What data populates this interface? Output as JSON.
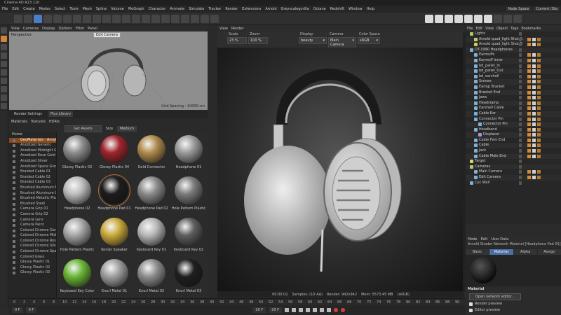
{
  "app": {
    "title": "Cinema 4D R23.110"
  },
  "menu": {
    "items": [
      "File",
      "Edit",
      "Create",
      "Modes",
      "Select",
      "Tools",
      "Mesh",
      "Spline",
      "Volume",
      "MoGraph",
      "Character",
      "Animate",
      "Simulate",
      "Tracker",
      "Render",
      "Extensions",
      "Arnold",
      "Greyscalegorilla",
      "Octane",
      "Redshift",
      "Window",
      "Help"
    ],
    "node_space": "Node Space",
    "node_space_value": "Current (Sta"
  },
  "viewport": {
    "menu": [
      "View",
      "Cameras",
      "Display",
      "Options",
      "Filter",
      "Panel"
    ],
    "label": "Perspective",
    "camera": "Edit Camera",
    "grid_spacing": "Grid Spacing : 10000 cm"
  },
  "material_manager": {
    "tabs": [
      "Render Settings",
      "Plus Library"
    ],
    "menu": [
      "Materials",
      "Textures",
      "HDRIs"
    ],
    "get_assets": "Get Assets",
    "size_label": "Size",
    "size_value": "Medium",
    "list_head": "Home",
    "list_selected": "GeoMaterials - Arnold",
    "list": [
      "Anodized Generic",
      "Anodized Midnight Gre",
      "Anodized Rose Gold",
      "Anodized Silver",
      "Anodized Space Grey",
      "Braided Cable 01",
      "Braided Cable 02",
      "Braided Cable 03",
      "Brushed Aluminum Ble",
      "Brushed Aluminum Gra",
      "Brushed Metallic Plastic",
      "Brushed Steel",
      "Camera Grip 01",
      "Camera Grip 02",
      "Camera Lens",
      "Camera Paint",
      "Colored Chrome Gener",
      "Colored Chrome Midni",
      "Colored Chrome Rose",
      "Colored Chrome Silver",
      "Colored Chrome Space",
      "Colored Glass",
      "Glossy Plastic 01",
      "Glossy Plastic 02",
      "Glossy Plastic 03"
    ],
    "grid": [
      {
        "name": "Glossy Plastic 03",
        "color": "#8c8c8c"
      },
      {
        "name": "Glossy Plastic 04",
        "color": "#a0242c"
      },
      {
        "name": "Gold Connector",
        "color": "#b08b4a"
      },
      {
        "name": "Headphone 01",
        "color": "#9a9a9a"
      },
      {
        "name": "Headphone 02",
        "color": "#bdbdbd"
      },
      {
        "name": "Headphone Pad 01",
        "color": "#1c1c1c"
      },
      {
        "name": "Headphone Pad 02",
        "color": "#8a8a8a"
      },
      {
        "name": "Hole Pattern Plastic",
        "color": "#7a7a7a"
      },
      {
        "name": "Hole Pattern Plastic",
        "color": "#a6a6a6"
      },
      {
        "name": "Kevlar Speaker",
        "color": "#c9a83a"
      },
      {
        "name": "Keyboard Key 01",
        "color": "#b7b7b7"
      },
      {
        "name": "Keyboard Key 02",
        "color": "#5e5e5e"
      },
      {
        "name": "Keyboard Key Color",
        "color": "#6ab636"
      },
      {
        "name": "Knurl Metal 01",
        "color": "#9e9e9e"
      },
      {
        "name": "Knurl Metal 02",
        "color": "#8d8d8d"
      },
      {
        "name": "Knurl Metal 03",
        "color": "#1f1f1f"
      }
    ]
  },
  "render_view": {
    "menu": [
      "View",
      "Render"
    ],
    "options": [
      {
        "label": "Scale",
        "value": "23 %"
      },
      {
        "label": "Zoom",
        "value": "100 %"
      },
      {
        "label": "Display",
        "value": "beauty"
      },
      {
        "label": "Camera",
        "value": "Main Camera"
      },
      {
        "label": "Color Space",
        "value": "sRGB"
      }
    ],
    "status": [
      "00:00:02",
      "Samples: (10 AA)",
      "Render: 942x942",
      "Mem: 5573.45 MB",
      "(sRGB)"
    ]
  },
  "object_manager": {
    "menu": [
      "File",
      "Edit",
      "View",
      "Object",
      "Tags",
      "Bookmarks"
    ],
    "items": [
      {
        "name": "Lights",
        "indent": 0,
        "color": "#b0c96a"
      },
      {
        "name": "Arnold quad_light Shot A",
        "indent": 1,
        "color": "#c9c96a"
      },
      {
        "name": "Arnold quad_light Shot B",
        "indent": 1,
        "color": "#c9c96a"
      },
      {
        "name": "DT-1990 Headphones",
        "indent": 0,
        "color": "#7fb0d8"
      },
      {
        "name": "Earmuffs",
        "indent": 1,
        "color": "#7fb0d8"
      },
      {
        "name": "Earmuff Inner",
        "indent": 1,
        "color": "#7fb0d8"
      },
      {
        "name": "bd_pallet_In",
        "indent": 1,
        "color": "#7fb0d8"
      },
      {
        "name": "bd_pallet_Out",
        "indent": 1,
        "color": "#7fb0d8"
      },
      {
        "name": "bd_earshell",
        "indent": 1,
        "color": "#7fb0d8"
      },
      {
        "name": "Screws",
        "indent": 1,
        "color": "#7fb0d8"
      },
      {
        "name": "Earlap Bracket",
        "indent": 1,
        "color": "#7fb0d8"
      },
      {
        "name": "Bracket End",
        "indent": 1,
        "color": "#7fb0d8"
      },
      {
        "name": "Jaws",
        "indent": 1,
        "color": "#7fb0d8"
      },
      {
        "name": "Headclamp",
        "indent": 1,
        "color": "#7fb0d8"
      },
      {
        "name": "Earshell Cable",
        "indent": 1,
        "color": "#7fb0d8"
      },
      {
        "name": "Cable Ear",
        "indent": 1,
        "color": "#7fb0d8"
      },
      {
        "name": "Connector Pin",
        "indent": 1,
        "color": "#7fb0d8"
      },
      {
        "name": "Connector Pin",
        "indent": 2,
        "color": "#7fb0d8"
      },
      {
        "name": "Headband",
        "indent": 1,
        "color": "#7fb0d8"
      },
      {
        "name": "Displacer",
        "indent": 2,
        "color": "#b48bd8"
      },
      {
        "name": "Cable Fem End",
        "indent": 1,
        "color": "#7fb0d8"
      },
      {
        "name": "Cable",
        "indent": 1,
        "color": "#7fb0d8"
      },
      {
        "name": "Jack",
        "indent": 1,
        "color": "#7fb0d8"
      },
      {
        "name": "Cable Male End",
        "indent": 1,
        "color": "#7fb0d8"
      },
      {
        "name": "Target",
        "indent": 0,
        "color": "#d8d86a"
      },
      {
        "name": "Cameras",
        "indent": 0,
        "color": "#b0c96a"
      },
      {
        "name": "Main Camera",
        "indent": 1,
        "color": "#7fb0d8"
      },
      {
        "name": "Edit Camera",
        "indent": 1,
        "color": "#7fb0d8"
      },
      {
        "name": "Cyc Wall",
        "indent": 0,
        "color": "#7fb0d8"
      }
    ]
  },
  "attribute_manager": {
    "menu": [
      "Mode",
      "Edit",
      "User Data"
    ],
    "title": "Arnold Shader Network Material [Headphone Pad 01]",
    "tabs": [
      "Basic",
      "Material",
      "Alpha (stacking)",
      "Assign"
    ],
    "section": "Material",
    "network_button": "Open network editor...",
    "checkboxes": [
      "Render preview",
      "Editor preview"
    ]
  },
  "timeline": {
    "ticks": [
      "0",
      "2",
      "4",
      "6",
      "8",
      "10",
      "12",
      "14",
      "16",
      "18",
      "20",
      "22",
      "24",
      "26",
      "28",
      "30",
      "32",
      "34",
      "36",
      "38",
      "40",
      "42",
      "44",
      "46",
      "48",
      "50",
      "52",
      "54",
      "56",
      "58",
      "60",
      "62",
      "64",
      "66",
      "68",
      "70",
      "72",
      "74",
      "76",
      "78",
      "80",
      "82",
      "84",
      "86",
      "88",
      "90"
    ],
    "start": "0 F",
    "start2": "0 F",
    "end": "20 F",
    "end2": "20 F"
  }
}
